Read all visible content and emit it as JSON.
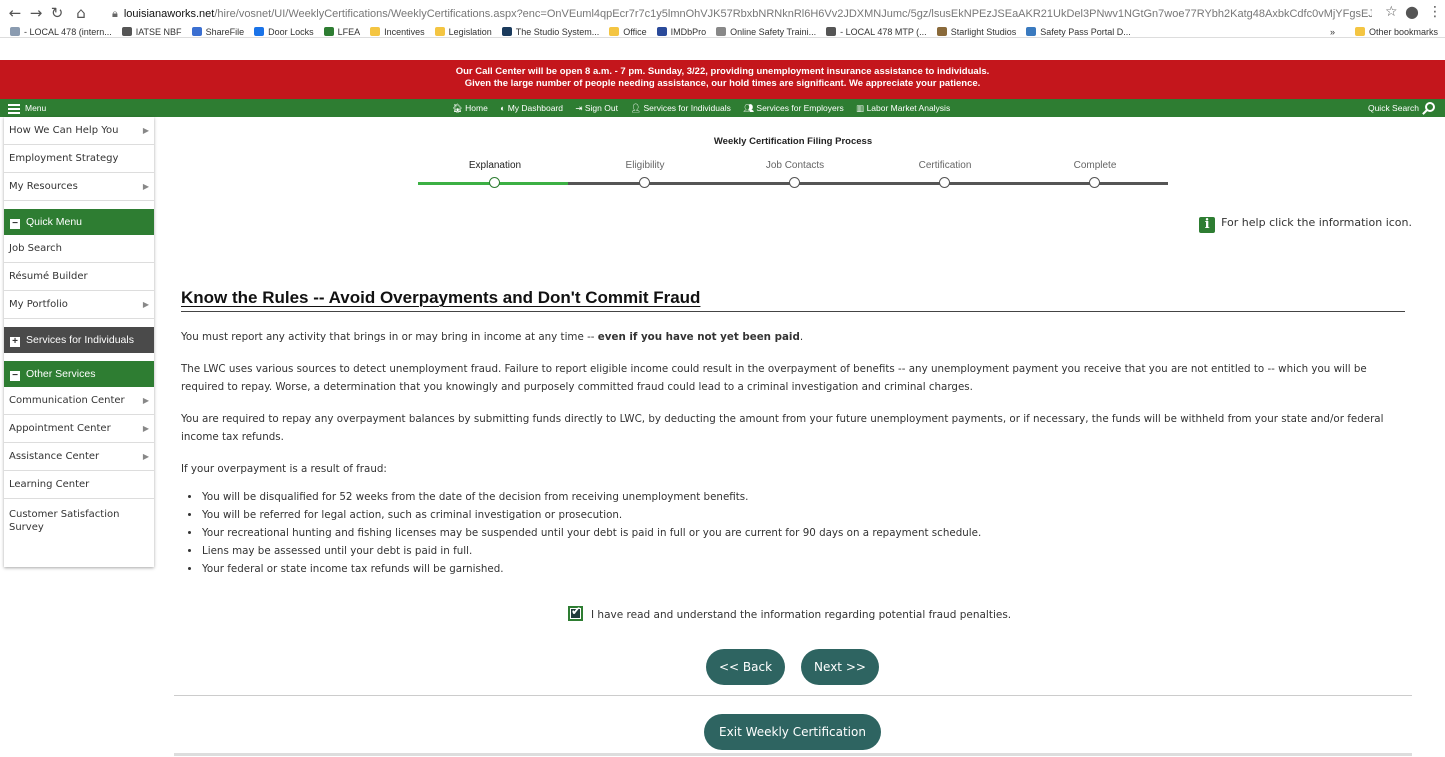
{
  "browser": {
    "url_host": "louisianaworks.net",
    "url_path": "/hire/vosnet/UI/WeeklyCertifications/WeeklyCertifications.aspx?enc=OnVEuml4qpEcr7r7c1y5lmnOhVJK57RbxbNRNknRl6H6Vv2JDXMNJumc/5gz/lsusEkNPEzJSEaAKR21UkDel3PNwv1NGtGn7woe77RYbh2Katg48AxbkCdfc0vMjYFgsEJHWPP...",
    "bookmarks": [
      {
        "label": "- LOCAL 478 (intern...",
        "color": "#8a9bb0"
      },
      {
        "label": "IATSE NBF",
        "color": "#555"
      },
      {
        "label": "ShareFile",
        "color": "#3b6fd1"
      },
      {
        "label": "Door Locks",
        "color": "#1a73e8"
      },
      {
        "label": "LFEA",
        "color": "#2e7d32"
      },
      {
        "label": "Incentives",
        "color": "#f4c542"
      },
      {
        "label": "Legislation",
        "color": "#f4c542"
      },
      {
        "label": "The Studio System...",
        "color": "#1a3a5c"
      },
      {
        "label": "Office",
        "color": "#f4c542"
      },
      {
        "label": "IMDbPro",
        "color": "#2a4a9a"
      },
      {
        "label": "Online Safety Traini...",
        "color": "#888"
      },
      {
        "label": "- LOCAL 478 MTP (...",
        "color": "#555"
      },
      {
        "label": "Starlight Studios",
        "color": "#8a6a3a"
      },
      {
        "label": "Safety Pass Portal D...",
        "color": "#3a7abf"
      }
    ],
    "other_bookmarks": "Other bookmarks",
    "bookmark_overflow": "»"
  },
  "alert": {
    "line1": "Our Call Center will be open 8 a.m. - 7 pm. Sunday, 3/22, providing unemployment insurance assistance to individuals.",
    "line2": "Given the large number of people needing assistance, our hold times are significant. We appreciate your patience."
  },
  "topnav": {
    "menu_label": "Menu",
    "links": [
      "Home",
      "My Dashboard",
      "Sign Out",
      "Services for Individuals",
      "Services for Employers",
      "Labor Market Analysis"
    ],
    "quick_search": "Quick Search"
  },
  "sidebar": {
    "top_items": [
      "How We Can Help You",
      "Employment Strategy",
      "My Resources"
    ],
    "quick_menu_title": "Quick Menu",
    "quick_menu_items": [
      "Job Search",
      "Résumé Builder",
      "My Portfolio"
    ],
    "services_individuals_title": "Services for Individuals",
    "other_services_title": "Other Services",
    "other_services_items": [
      "Communication Center",
      "Appointment Center",
      "Assistance Center",
      "Learning Center",
      "Customer Satisfaction Survey"
    ]
  },
  "main": {
    "process_title": "Weekly Certification Filing Process",
    "steps": [
      "Explanation",
      "Eligibility",
      "Job Contacts",
      "Certification",
      "Complete"
    ],
    "active_step": "Explanation",
    "help_text": "For help click the information icon.",
    "page_title": "Know the Rules -- Avoid Overpayments and Don't Commit Fraud",
    "para1_a": "You must report any activity that brings in or may bring in income at any time -- ",
    "para1_b": "even if you have not yet been paid",
    "para1_c": ".",
    "para2": "The LWC uses various sources to detect unemployment fraud. Failure to report eligible income could result in the overpayment of benefits -- any unemployment payment you receive that you are not entitled to -- which you will be required to repay. Worse, a determination that you knowingly and purposely committed fraud could lead to a criminal investigation and criminal charges.",
    "para3": "You are required to repay any overpayment balances by submitting funds directly to LWC, by deducting the amount from your future unemployment payments, or if necessary, the funds will be withheld from your state and/or federal income tax refunds.",
    "para4": "If your overpayment is a result of fraud:",
    "bullets": [
      "You will be disqualified for 52 weeks from the date of the decision from receiving unemployment benefits.",
      "You will be referred for legal action, such as criminal investigation or prosecution.",
      "Your recreational hunting and fishing licenses may be suspended until your debt is paid in full or you are current for 90 days on a repayment schedule.",
      "Liens may be assessed until your debt is paid in full.",
      "Your federal or state income tax refunds will be garnished."
    ],
    "ack_text": "I have read and understand the information regarding potential fraud penalties.",
    "ack_checked": true,
    "back_label": "<< Back",
    "next_label": "Next >>",
    "exit_label": "Exit Weekly Certification"
  },
  "colors": {
    "brand_green": "#2e7d32",
    "alert_red": "#c4161c",
    "button_teal": "#2e6461",
    "progress_green": "#3cb044"
  }
}
